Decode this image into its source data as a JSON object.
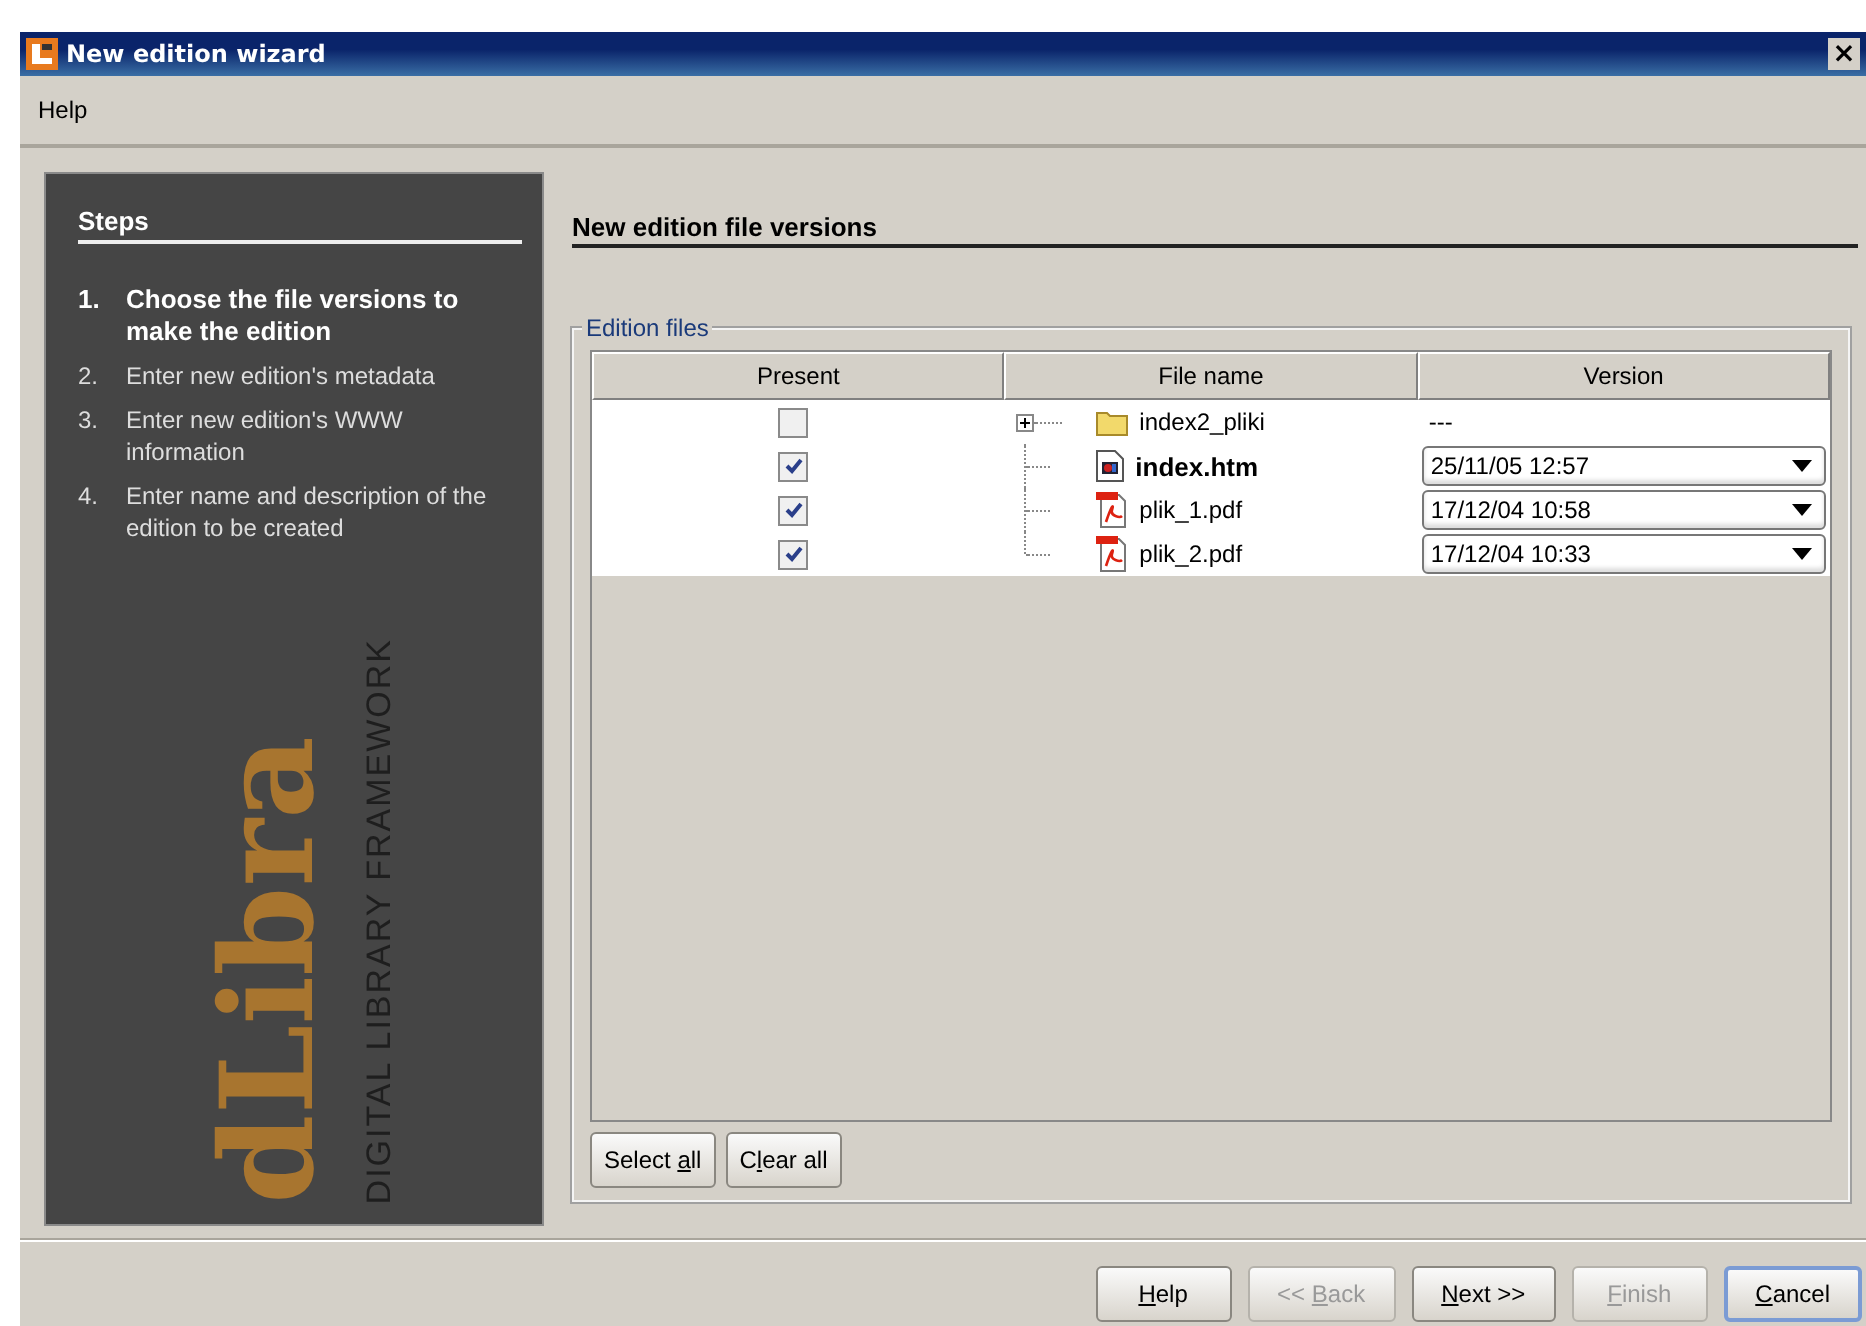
{
  "window": {
    "title": "New edition wizard",
    "close": "×"
  },
  "menu": [
    "Help"
  ],
  "steps": {
    "title": "Steps",
    "items": [
      {
        "number": "1.",
        "text": "Choose the file versions to make the edition",
        "selected": true
      },
      {
        "number": "2.",
        "text": "Enter new edition's metadata",
        "selected": false
      },
      {
        "number": "3.",
        "text": "Enter new edition's WWW information",
        "selected": false
      },
      {
        "number": "4.",
        "text": "Enter name and description of the edition to be created",
        "selected": false
      }
    ],
    "logo": {
      "wordmark": "dLibra",
      "tagline": "DIGITAL LIBRARY FRAMEWORK"
    }
  },
  "page": {
    "title": "New edition file versions",
    "group": "Edition files",
    "table": {
      "columns": [
        "Present",
        "File name",
        "Version"
      ],
      "rows": [
        {
          "checked": false,
          "kind": "folder",
          "expanded": false,
          "name": "index2_pliki",
          "bold": false,
          "version": {
            "kind": "text",
            "value": "---"
          }
        },
        {
          "checked": true,
          "kind": "html",
          "name": "index.htm",
          "bold": true,
          "version": {
            "kind": "dropdown",
            "value": "25/11/05 12:57"
          }
        },
        {
          "checked": true,
          "kind": "pdf",
          "name": "plik_1.pdf",
          "bold": false,
          "version": {
            "kind": "dropdown",
            "value": "17/12/04 10:58"
          }
        },
        {
          "checked": true,
          "kind": "pdf",
          "name": "plik_2.pdf",
          "bold": false,
          "version": {
            "kind": "dropdown",
            "value": "17/12/04 10:33"
          }
        }
      ]
    },
    "buttons": [
      {
        "before": "Select ",
        "key": "a",
        "after": "ll"
      },
      {
        "before": "C",
        "key": "l",
        "after": "ear all"
      }
    ]
  },
  "footer_buttons": [
    {
      "key": "H",
      "after": "elp",
      "disabled": false,
      "default": false
    },
    {
      "before": "<< ",
      "key": "B",
      "after": "ack",
      "disabled": true,
      "default": false
    },
    {
      "key": "N",
      "after": "ext >>",
      "disabled": false,
      "default": false
    },
    {
      "key": "F",
      "after": "inish",
      "disabled": true,
      "default": false
    },
    {
      "key": "C",
      "after": "ancel",
      "disabled": false,
      "default": true
    }
  ]
}
